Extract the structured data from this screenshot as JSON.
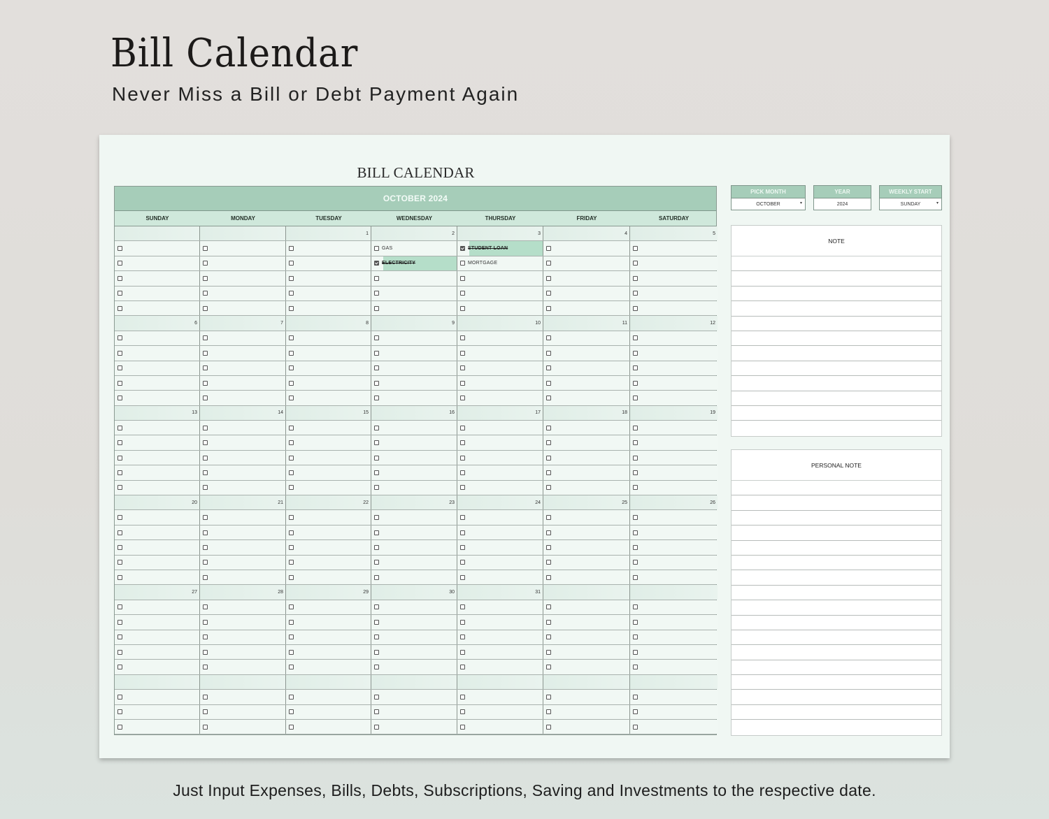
{
  "hero": {
    "title": "Bill Calendar",
    "subtitle": "Never Miss a Bill or Debt Payment Again"
  },
  "footer": {
    "text": "Just Input Expenses, Bills, Debts, Subscriptions, Saving and Investments to the respective date."
  },
  "colors": {
    "accent": "#a6cdb9",
    "day_header": "#cfe8db",
    "highlight": "#b5dec9",
    "sheet_bg": "#f0f7f3"
  },
  "sheet": {
    "title": "BILL CALENDAR",
    "month_header": "OCTOBER 2024",
    "days_of_week": [
      "SUNDAY",
      "MONDAY",
      "TUESDAY",
      "WEDNESDAY",
      "THURSDAY",
      "FRIDAY",
      "SATURDAY"
    ],
    "weeks": [
      {
        "dates": [
          "",
          "",
          "1",
          "2",
          "3",
          "4",
          "5"
        ],
        "rows": [
          [
            {},
            {},
            {},
            {
              "label": "GAS",
              "checked": false
            },
            {
              "label": "STUDENT LOAN",
              "checked": true
            },
            {},
            {}
          ],
          [
            {},
            {},
            {},
            {
              "label": "ELECTRICITY",
              "checked": true
            },
            {
              "label": "MORTGAGE",
              "checked": false
            },
            {},
            {}
          ],
          [
            {},
            {},
            {},
            {},
            {},
            {},
            {}
          ],
          [
            {},
            {},
            {},
            {},
            {},
            {},
            {}
          ],
          [
            {},
            {},
            {},
            {},
            {},
            {},
            {}
          ]
        ]
      },
      {
        "dates": [
          "6",
          "7",
          "8",
          "9",
          "10",
          "11",
          "12"
        ],
        "row_count": 5
      },
      {
        "dates": [
          "13",
          "14",
          "15",
          "16",
          "17",
          "18",
          "19"
        ],
        "row_count": 5
      },
      {
        "dates": [
          "20",
          "21",
          "22",
          "23",
          "24",
          "25",
          "26"
        ],
        "row_count": 5
      },
      {
        "dates": [
          "27",
          "28",
          "29",
          "30",
          "31",
          "",
          ""
        ],
        "row_count": 5
      },
      {
        "dates": [
          "",
          "",
          "",
          "",
          "",
          "",
          ""
        ],
        "row_count": 3
      }
    ]
  },
  "pickers": [
    {
      "label": "PICK MONTH",
      "value": "OCTOBER",
      "has_dropdown": true
    },
    {
      "label": "YEAR",
      "value": "2024",
      "has_dropdown": false
    },
    {
      "label": "WEEKLY START",
      "value": "SUNDAY",
      "has_dropdown": true
    }
  ],
  "notes": {
    "note_title": "NOTE",
    "note_lines": 12,
    "personal_title": "PERSONAL NOTE",
    "personal_lines": 17
  }
}
